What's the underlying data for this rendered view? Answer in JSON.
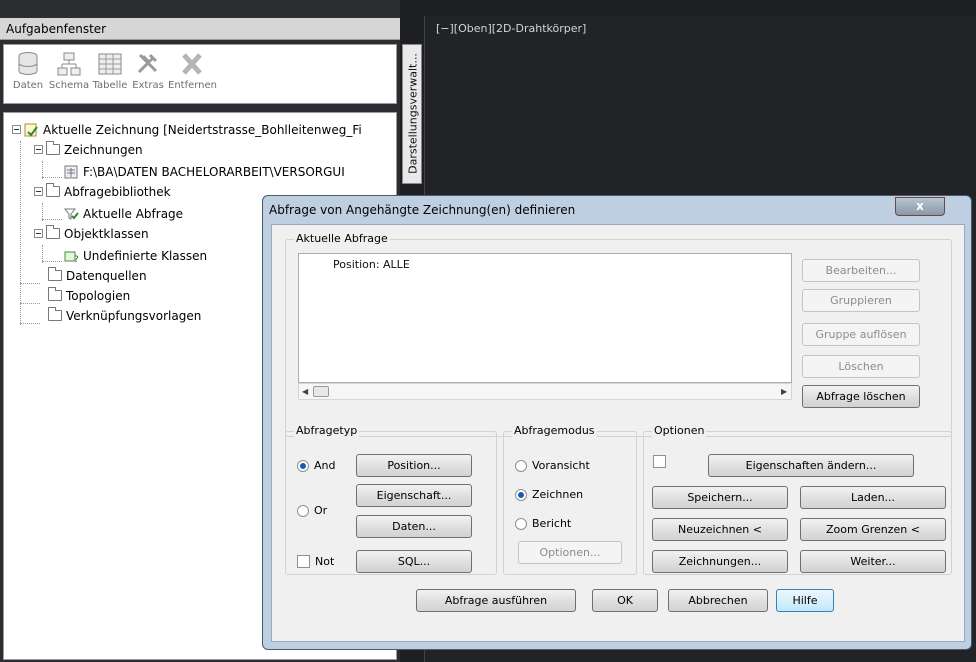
{
  "taskpane": {
    "title": "Aufgabenfenster",
    "toolbar": [
      {
        "label": "Daten",
        "icon": "database-icon"
      },
      {
        "label": "Schema",
        "icon": "schema-icon"
      },
      {
        "label": "Tabelle",
        "icon": "table-icon"
      },
      {
        "label": "Extras",
        "icon": "tools-icon"
      },
      {
        "label": "Entfernen",
        "icon": "remove-icon"
      }
    ],
    "side_tab": "Darstellungsverwalt...",
    "tree": {
      "root": "Aktuelle Zeichnung [Neidertstrasse_Bohlleitenweg_Fi",
      "zeichnungen": "Zeichnungen",
      "zeichnung_path": "F:\\BA\\DATEN BACHELORARBEIT\\VERSORGUI",
      "abfragebibliothek": "Abfragebibliothek",
      "aktuelle_abfrage": "Aktuelle Abfrage",
      "objektklassen": "Objektklassen",
      "undefinierte": "Undefinierte Klassen",
      "datenquellen": "Datenquellen",
      "topologien": "Topologien",
      "verknuepfung": "Verknüpfungsvorlagen"
    }
  },
  "viewport": {
    "label": "[−][Oben][2D-Drahtkörper]"
  },
  "dialog": {
    "title": "Abfrage von Angehängte Zeichnung(en) definieren",
    "close": "x",
    "current_query": {
      "group": "Aktuelle Abfrage",
      "text": "Position: ALLE",
      "buttons": {
        "bearbeiten": "Bearbeiten...",
        "gruppieren": "Gruppieren",
        "gruppe_aufloesen": "Gruppe auflösen",
        "loeschen": "Löschen",
        "abfrage_loeschen": "Abfrage löschen"
      }
    },
    "abfragetyp": {
      "group": "Abfragetyp",
      "and": "And",
      "or": "Or",
      "not": "Not",
      "position": "Position...",
      "eigenschaft": "Eigenschaft...",
      "daten": "Daten...",
      "sql": "SQL...",
      "selected": "And"
    },
    "abfragemodus": {
      "group": "Abfragemodus",
      "voransicht": "Voransicht",
      "zeichnen": "Zeichnen",
      "bericht": "Bericht",
      "optionen": "Optionen...",
      "selected": "Zeichnen"
    },
    "optionen": {
      "group": "Optionen",
      "eigenschaften": "Eigenschaften ändern...",
      "speichern": "Speichern...",
      "laden": "Laden...",
      "neuzeichnen": "Neuzeichnen <",
      "zoom": "Zoom Grenzen <",
      "zeichnungen": "Zeichnungen...",
      "weiter": "Weiter..."
    },
    "footer": {
      "ausfuehren": "Abfrage ausführen",
      "ok": "OK",
      "abbrechen": "Abbrechen",
      "hilfe": "Hilfe"
    }
  },
  "colors": {
    "dialog_frame": "#bfcfe2",
    "viewport_bg": "#212326",
    "radio_selected": "#1a59b8"
  }
}
